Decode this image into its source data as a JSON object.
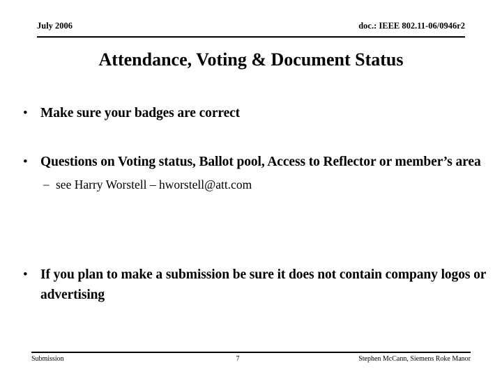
{
  "header": {
    "date": "July 2006",
    "doc_reference": "doc.: IEEE 802.11-06/0946r2"
  },
  "title": "Attendance, Voting & Document Status",
  "body": {
    "bullets": [
      {
        "marker": "•",
        "text": "Make sure your badges are correct"
      },
      {
        "marker": "•",
        "text": "Questions on Voting status, Ballot pool, Access to Reflector or member’s area",
        "sub": [
          {
            "marker": "–",
            "text": "see Harry Worstell –  hworstell@att.com"
          }
        ]
      },
      {
        "marker": "•",
        "text": "If you plan to make a submission be sure it does not contain company logos or advertising"
      }
    ]
  },
  "footer": {
    "left": "Submission",
    "page_number": "7",
    "right": "Stephen McCann, Siemens Roke Manor"
  },
  "colors": {
    "text": "#000000",
    "background": "#ffffff",
    "rule": "#000000"
  }
}
